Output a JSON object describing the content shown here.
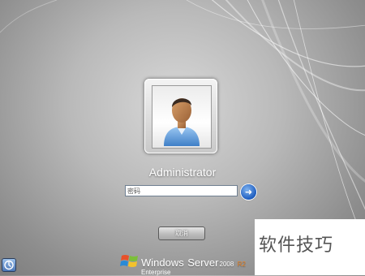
{
  "login": {
    "username": "Administrator",
    "password_placeholder": "密码",
    "cancel_label": "取消"
  },
  "branding": {
    "product_windows": "Windows",
    "product_server": "Server",
    "product_year": "2008",
    "product_release": "R2",
    "edition": "Enterprise"
  },
  "watermark": {
    "text": "软件技巧"
  },
  "icons": {
    "avatar": "user-avatar-icon",
    "submit": "arrow-right-icon",
    "ease_of_access": "ease-of-access-icon",
    "logo": "windows-flag-icon"
  },
  "colors": {
    "submit_blue": "#1e5dbf",
    "release_orange": "#e67e1e",
    "background_grey": "#b9b9b9"
  }
}
